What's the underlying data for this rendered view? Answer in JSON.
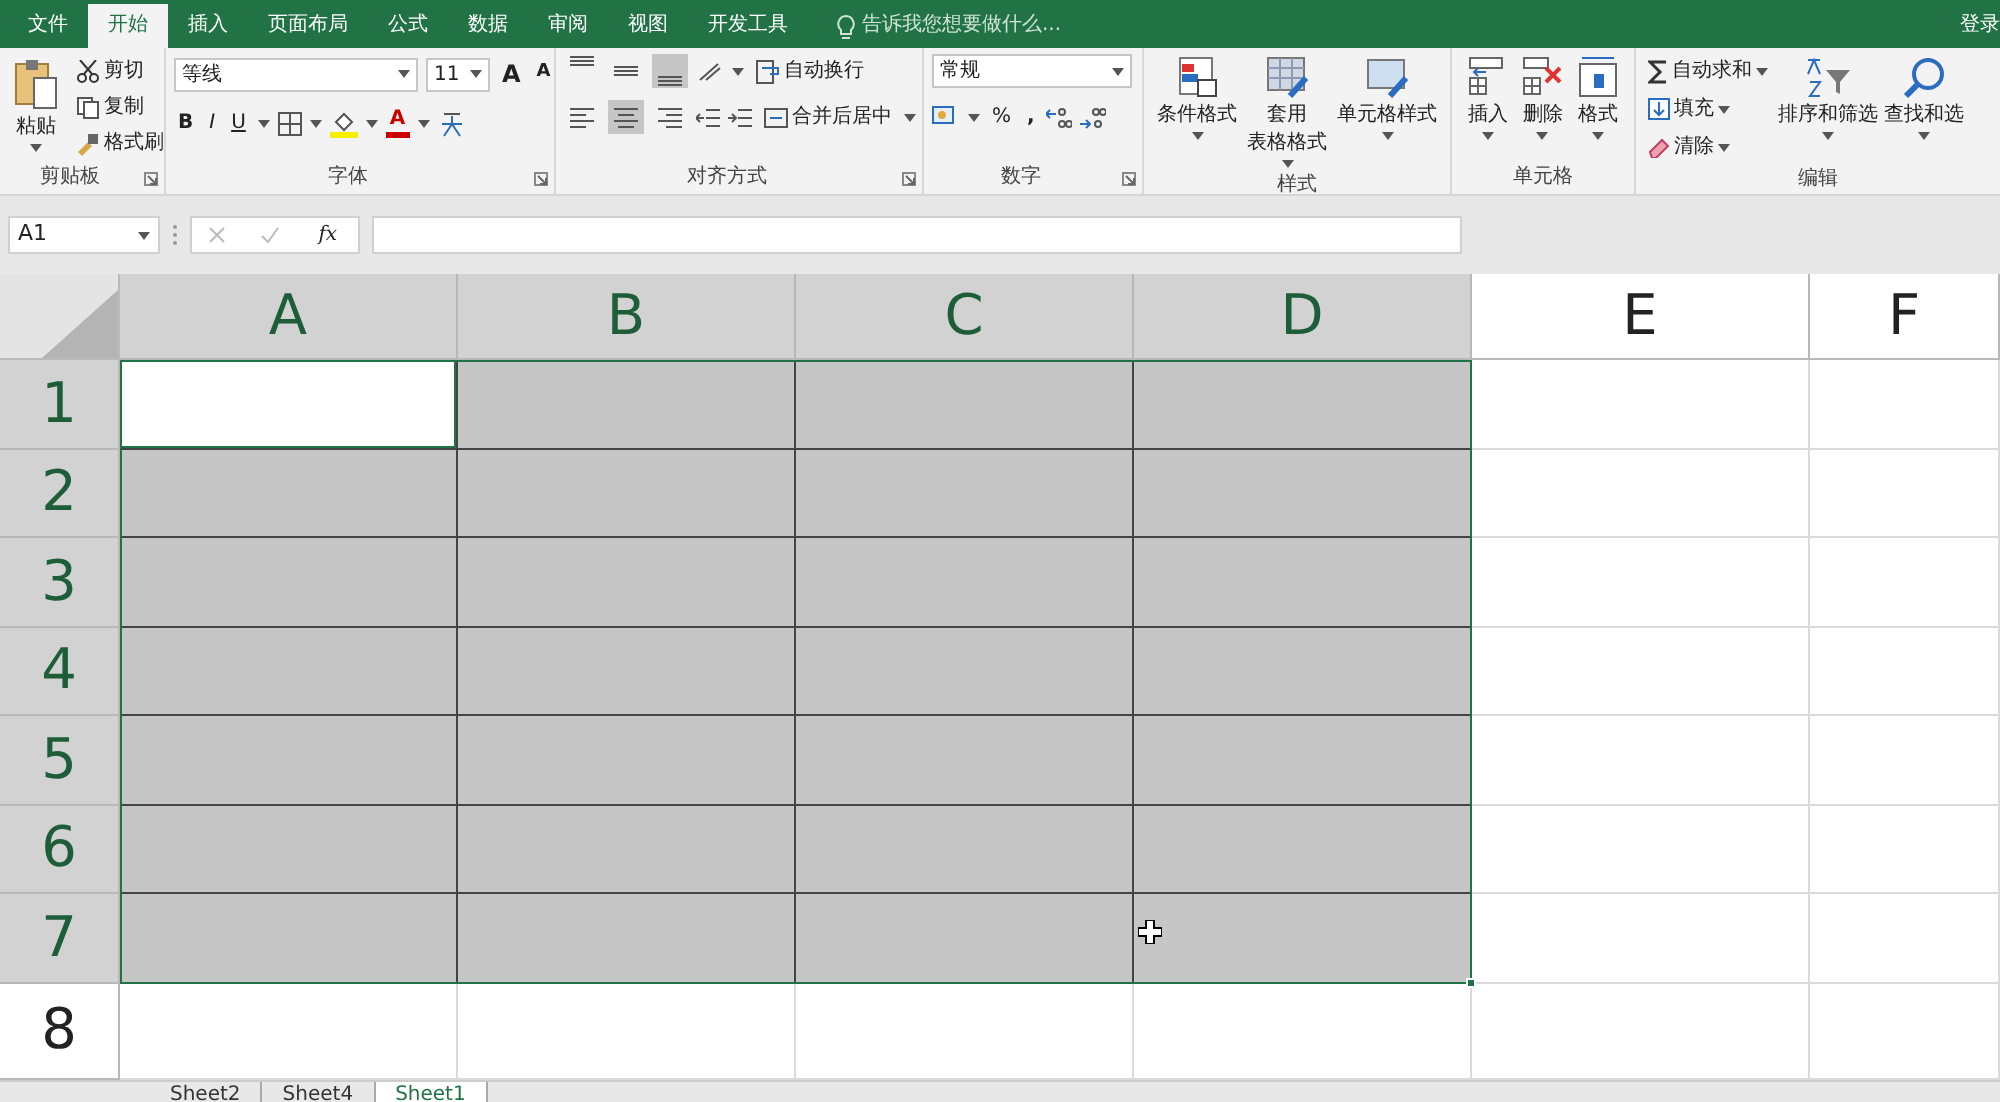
{
  "menu_tabs": [
    {
      "label": "文件",
      "selected": false
    },
    {
      "label": "开始",
      "selected": true
    },
    {
      "label": "插入",
      "selected": false
    },
    {
      "label": "页面布局",
      "selected": false
    },
    {
      "label": "公式",
      "selected": false
    },
    {
      "label": "数据",
      "selected": false
    },
    {
      "label": "审阅",
      "selected": false
    },
    {
      "label": "视图",
      "selected": false
    },
    {
      "label": "开发工具",
      "selected": false
    }
  ],
  "tell_me": "告诉我您想要做什么...",
  "sign_in": "登录",
  "ribbon": {
    "clipboard": {
      "label": "剪贴板",
      "paste": "粘贴",
      "cut": "剪切",
      "copy": "复制",
      "format_painter": "格式刷"
    },
    "font": {
      "label": "字体",
      "font_name": "等线",
      "font_size": "11",
      "grow": "A",
      "shrink": "A",
      "bold": "B",
      "italic": "I",
      "underline": "U",
      "font_color": "A"
    },
    "alignment": {
      "label": "对齐方式",
      "vertical": [
        {
          "kind": "top",
          "selected": false
        },
        {
          "kind": "middle",
          "selected": false
        },
        {
          "kind": "bottom",
          "selected": true
        }
      ],
      "horizontal": [
        {
          "kind": "left",
          "selected": false
        },
        {
          "kind": "center",
          "selected": true
        },
        {
          "kind": "right",
          "selected": false
        }
      ],
      "wrap_text": "自动换行",
      "merge_center": "合并后居中"
    },
    "number": {
      "label": "数字",
      "format": "常规",
      "percent": "%",
      "comma": ","
    },
    "styles": {
      "label": "样式",
      "buttons": [
        {
          "kind": "conditional",
          "lines": [
            "条件格式"
          ]
        },
        {
          "kind": "table",
          "lines": [
            "套用",
            "表格格式"
          ]
        },
        {
          "kind": "cellstyle",
          "lines": [
            "单元格样式"
          ]
        }
      ]
    },
    "cells": {
      "label": "单元格",
      "buttons": [
        {
          "kind": "insert",
          "label": "插入"
        },
        {
          "kind": "delete",
          "label": "删除"
        },
        {
          "kind": "format",
          "label": "格式"
        }
      ]
    },
    "editing": {
      "label": "编辑",
      "autosum": "自动求和",
      "fill": "填充",
      "clear": "清除",
      "sort": "排序和筛选",
      "find": "查找和选"
    }
  },
  "formula_bar": {
    "name_box": "A1",
    "fx": "fx"
  },
  "grid": {
    "columns": [
      {
        "label": "A",
        "selected": true
      },
      {
        "label": "B",
        "selected": true
      },
      {
        "label": "C",
        "selected": true
      },
      {
        "label": "D",
        "selected": true
      },
      {
        "label": "E",
        "selected": false
      },
      {
        "label": "F",
        "selected": false
      }
    ],
    "rows": [
      {
        "label": "1",
        "selected": true,
        "cells": [
          {
            "selected": true,
            "active": true
          },
          {
            "selected": true,
            "active": false
          },
          {
            "selected": true,
            "active": false
          },
          {
            "selected": true,
            "active": false
          },
          {
            "selected": false,
            "active": false
          },
          {
            "selected": false,
            "active": false
          }
        ]
      },
      {
        "label": "2",
        "selected": true,
        "cells": [
          {
            "selected": true,
            "active": false
          },
          {
            "selected": true,
            "active": false
          },
          {
            "selected": true,
            "active": false
          },
          {
            "selected": true,
            "active": false
          },
          {
            "selected": false,
            "active": false
          },
          {
            "selected": false,
            "active": false
          }
        ]
      },
      {
        "label": "3",
        "selected": true,
        "cells": [
          {
            "selected": true,
            "active": false
          },
          {
            "selected": true,
            "active": false
          },
          {
            "selected": true,
            "active": false
          },
          {
            "selected": true,
            "active": false
          },
          {
            "selected": false,
            "active": false
          },
          {
            "selected": false,
            "active": false
          }
        ]
      },
      {
        "label": "4",
        "selected": true,
        "cells": [
          {
            "selected": true,
            "active": false
          },
          {
            "selected": true,
            "active": false
          },
          {
            "selected": true,
            "active": false
          },
          {
            "selected": true,
            "active": false
          },
          {
            "selected": false,
            "active": false
          },
          {
            "selected": false,
            "active": false
          }
        ]
      },
      {
        "label": "5",
        "selected": true,
        "cells": [
          {
            "selected": true,
            "active": false
          },
          {
            "selected": true,
            "active": false
          },
          {
            "selected": true,
            "active": false
          },
          {
            "selected": true,
            "active": false
          },
          {
            "selected": false,
            "active": false
          },
          {
            "selected": false,
            "active": false
          }
        ]
      },
      {
        "label": "6",
        "selected": true,
        "cells": [
          {
            "selected": true,
            "active": false
          },
          {
            "selected": true,
            "active": false
          },
          {
            "selected": true,
            "active": false
          },
          {
            "selected": true,
            "active": false
          },
          {
            "selected": false,
            "active": false
          },
          {
            "selected": false,
            "active": false
          }
        ]
      },
      {
        "label": "7",
        "selected": true,
        "cells": [
          {
            "selected": true,
            "active": false
          },
          {
            "selected": true,
            "active": false
          },
          {
            "selected": true,
            "active": false
          },
          {
            "selected": true,
            "active": false
          },
          {
            "selected": false,
            "active": false
          },
          {
            "selected": false,
            "active": false
          }
        ]
      },
      {
        "label": "8",
        "selected": false,
        "cells": [
          {
            "selected": false,
            "active": false
          },
          {
            "selected": false,
            "active": false
          },
          {
            "selected": false,
            "active": false
          },
          {
            "selected": false,
            "active": false
          },
          {
            "selected": false,
            "active": false
          },
          {
            "selected": false,
            "active": false
          }
        ]
      }
    ]
  },
  "sheet_tabs": [
    {
      "label": "Sheet2",
      "selected": false
    },
    {
      "label": "Sheet4",
      "selected": false
    },
    {
      "label": "Sheet1",
      "selected": true
    }
  ]
}
